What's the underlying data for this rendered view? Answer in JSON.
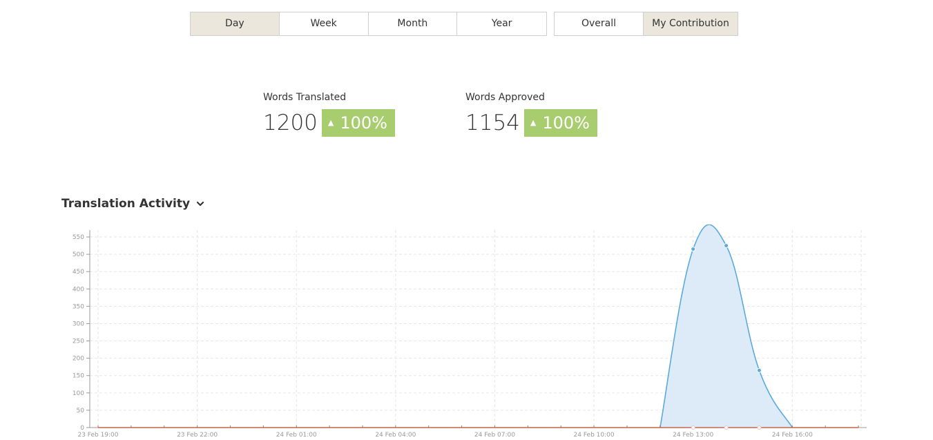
{
  "period_tabs": [
    {
      "label": "Day",
      "active": true
    },
    {
      "label": "Week",
      "active": false
    },
    {
      "label": "Month",
      "active": false
    },
    {
      "label": "Year",
      "active": false
    }
  ],
  "scope_tabs": [
    {
      "label": "Overall",
      "active": false
    },
    {
      "label": "My Contribution",
      "active": true
    }
  ],
  "stats": {
    "translated": {
      "label": "Words Translated",
      "value": "1200",
      "change": "100%"
    },
    "approved": {
      "label": "Words Approved",
      "value": "1154",
      "change": "100%"
    }
  },
  "section": {
    "title": "Translation Activity",
    "icon": "chevron-down-icon"
  },
  "colors": {
    "active_tab": "#ece7dc",
    "badge": "#a8cd6f",
    "series_translated": "#5aaadb",
    "series_translated_fill": "#dcebf7",
    "series_baseline": "#c0674a"
  },
  "chart_data": {
    "type": "area",
    "grid": true,
    "ylim": [
      0,
      570
    ],
    "y_ticks": [
      0,
      50,
      100,
      150,
      200,
      250,
      300,
      350,
      400,
      450,
      500,
      550
    ],
    "x_tick_labels": [
      "23 Feb 19:00",
      "23 Feb 22:00",
      "24 Feb 01:00",
      "24 Feb 04:00",
      "24 Feb 07:00",
      "24 Feb 10:00",
      "24 Feb 13:00",
      "24 Feb 16:00"
    ],
    "x_hours": [
      0,
      3,
      6,
      9,
      12,
      15,
      18,
      21
    ],
    "x_range_hours": [
      0,
      23.25
    ],
    "series": [
      {
        "points": [
          {
            "h": 0,
            "v": 0
          },
          {
            "h": 1,
            "v": 0
          },
          {
            "h": 2,
            "v": 0
          },
          {
            "h": 3,
            "v": 0
          },
          {
            "h": 4,
            "v": 0
          },
          {
            "h": 5,
            "v": 0
          },
          {
            "h": 6,
            "v": 0
          },
          {
            "h": 7,
            "v": 0
          },
          {
            "h": 8,
            "v": 0
          },
          {
            "h": 9,
            "v": 0
          },
          {
            "h": 10,
            "v": 0
          },
          {
            "h": 11,
            "v": 0
          },
          {
            "h": 12,
            "v": 0
          },
          {
            "h": 13,
            "v": 0
          },
          {
            "h": 14,
            "v": 0
          },
          {
            "h": 15,
            "v": 0
          },
          {
            "h": 16,
            "v": 0
          },
          {
            "h": 17,
            "v": 0
          },
          {
            "h": 18,
            "v": 515
          },
          {
            "h": 19,
            "v": 525
          },
          {
            "h": 20,
            "v": 165
          },
          {
            "h": 21,
            "v": 0
          },
          {
            "h": 22,
            "v": 0
          },
          {
            "h": 23,
            "v": 0
          }
        ]
      },
      {
        "points": [
          {
            "h": 0,
            "v": 0
          },
          {
            "h": 1,
            "v": 0
          },
          {
            "h": 2,
            "v": 0
          },
          {
            "h": 3,
            "v": 0
          },
          {
            "h": 4,
            "v": 0
          },
          {
            "h": 5,
            "v": 0
          },
          {
            "h": 6,
            "v": 0
          },
          {
            "h": 7,
            "v": 0
          },
          {
            "h": 8,
            "v": 0
          },
          {
            "h": 9,
            "v": 0
          },
          {
            "h": 10,
            "v": 0
          },
          {
            "h": 11,
            "v": 0
          },
          {
            "h": 12,
            "v": 0
          },
          {
            "h": 13,
            "v": 0
          },
          {
            "h": 14,
            "v": 0
          },
          {
            "h": 15,
            "v": 0
          },
          {
            "h": 16,
            "v": 0
          },
          {
            "h": 17,
            "v": 0
          },
          {
            "h": 18,
            "v": 0
          },
          {
            "h": 19,
            "v": 0
          },
          {
            "h": 20,
            "v": 0
          },
          {
            "h": 21,
            "v": 0
          },
          {
            "h": 22,
            "v": 0
          },
          {
            "h": 23,
            "v": 0
          }
        ]
      }
    ]
  }
}
